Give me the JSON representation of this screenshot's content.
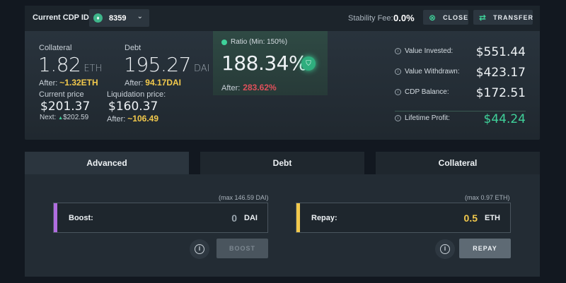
{
  "header": {
    "cdp_id_label": "Current CDP ID:",
    "cdp_id_value": "8359",
    "stability_fee_label": "Stability Fee:",
    "stability_fee_value": "0.0%",
    "close_label": "CLOSE",
    "transfer_label": "TRANSFER"
  },
  "collateral": {
    "label": "Collateral",
    "value": "1.82",
    "unit": "ETH",
    "after_label": "After:",
    "after_value": "~1.32ETH"
  },
  "debt": {
    "label": "Debt",
    "value": "195.27",
    "unit": "DAI",
    "after_label": "After:",
    "after_value": "94.17DAI"
  },
  "price": {
    "label": "Current price",
    "value": "$201.37",
    "next_label": "Next:",
    "next_value": "$202.59"
  },
  "liquidation": {
    "label": "Liquidation price:",
    "value": "$160.37",
    "after_label": "After:",
    "after_value": "~106.49"
  },
  "ratio": {
    "label": "Ratio (Min: 150%)",
    "value": "188.34%",
    "after_label": "After:",
    "after_value": "283.62%"
  },
  "summary": [
    {
      "label": "Value Invested:",
      "value": "$551.44"
    },
    {
      "label": "Value Withdrawn:",
      "value": "$423.17"
    },
    {
      "label": "CDP Balance:",
      "value": "$172.51"
    },
    {
      "label": "Lifetime Profit:",
      "value": "$44.24"
    }
  ],
  "tabs": [
    "Advanced",
    "Debt",
    "Collateral"
  ],
  "boost": {
    "max_note": "(max 146.59 DAI)",
    "label": "Boost:",
    "value": "0",
    "unit": "DAI",
    "button": "BOOST"
  },
  "repay": {
    "max_note": "(max 0.97 ETH)",
    "label": "Repay:",
    "value": "0.5",
    "unit": "ETH",
    "button": "REPAY"
  },
  "colors": {
    "accent_green": "#3fd29a",
    "warning_yellow": "#f2c94c",
    "danger_red": "#e0505a",
    "boost_bar": "#b06de0",
    "repay_bar": "#f2c94c"
  }
}
